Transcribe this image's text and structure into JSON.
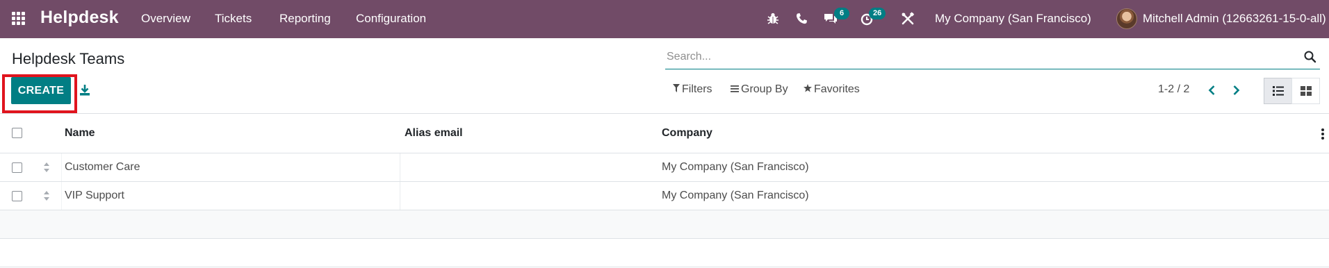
{
  "navbar": {
    "app_name": "Helpdesk",
    "menu": [
      "Overview",
      "Tickets",
      "Reporting",
      "Configuration"
    ],
    "messages_badge": "6",
    "activities_badge": "26",
    "company": "My Company (San Francisco)",
    "user": "Mitchell Admin (12663261-15-0-all)",
    "colors": {
      "bar": "#714b67",
      "badge": "#017e84"
    }
  },
  "control_panel": {
    "title": "Helpdesk Teams",
    "search_placeholder": "Search...",
    "create_label": "CREATE",
    "filters_label": "Filters",
    "group_by_label": "Group By",
    "favorites_label": "Favorites",
    "pager": "1-2 / 2",
    "accent_color": "#017e84",
    "highlight_color": "#e0141e"
  },
  "list": {
    "columns": [
      "Name",
      "Alias email",
      "Company"
    ],
    "rows": [
      {
        "name": "Customer Care",
        "alias_email": "",
        "company": "My Company (San Francisco)"
      },
      {
        "name": "VIP Support",
        "alias_email": "",
        "company": "My Company (San Francisco)"
      }
    ]
  }
}
